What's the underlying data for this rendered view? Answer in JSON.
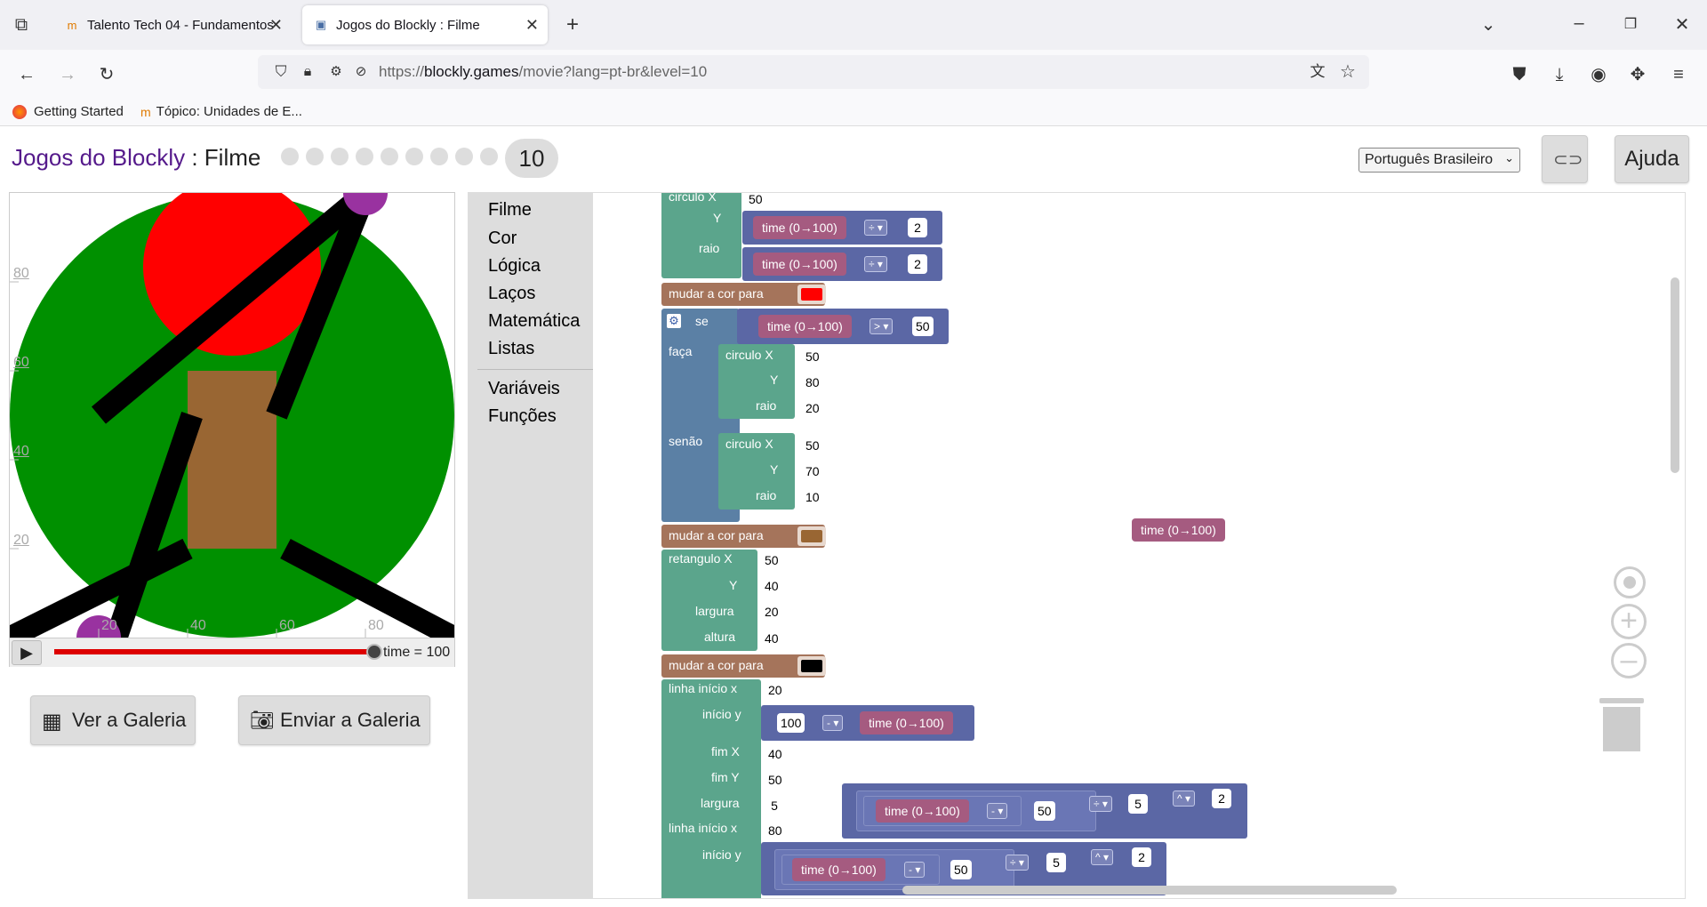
{
  "browser": {
    "tabs": [
      {
        "title": "Talento Tech 04 - Fundamentos",
        "active": false
      },
      {
        "title": "Jogos do Blockly : Filme",
        "active": true
      }
    ],
    "url_prefix": "https://",
    "url_host": "blockly.games",
    "url_path": "/movie?lang=pt-br&level=10",
    "bookmarks": [
      "Getting Started",
      "Tópico: Unidades de E..."
    ]
  },
  "header": {
    "app_link": "Jogos do Blockly",
    "separator": " : ",
    "page_name": "Filme",
    "level": "10",
    "language": "Português Brasileiro",
    "help": "Ajuda"
  },
  "movie": {
    "y_ticks": [
      "80",
      "60",
      "40",
      "20"
    ],
    "x_ticks": [
      "20",
      "40",
      "60",
      "80"
    ],
    "time_label": "time = 100",
    "progress": 1.0
  },
  "gallery": {
    "view": "Ver a Galeria",
    "submit": "Enviar a Galeria"
  },
  "toolbox": [
    "Filme",
    "Cor",
    "Lógica",
    "Laços",
    "Matemática",
    "Listas",
    "Variáveis",
    "Funções"
  ],
  "blocks": {
    "circle1_x_label": "circulo X",
    "circle1_x": "50",
    "y_label": "Y",
    "radius_label": "raio",
    "time": "time (0→100)",
    "div": "÷ ▾",
    "two": "2",
    "set_color": "mudar a cor para",
    "red": "#ff0000",
    "brown": "#996633",
    "black": "#000000",
    "if": "se",
    "gt": "> ▾",
    "fifty": "50",
    "do": "faça",
    "else": "senão",
    "c2x": "50",
    "c2y": "80",
    "c2r": "20",
    "c3x": "50",
    "c3y": "70",
    "c3r": "10",
    "rect_label": "retangulo X",
    "rect_x": "50",
    "rect_y": "40",
    "width_label": "largura",
    "rect_w": "20",
    "height_label": "altura",
    "rect_h": "40",
    "line_start_x": "linha início x",
    "line1_x": "20",
    "start_y": "início y",
    "hundred": "100",
    "minus": "- ▾",
    "end_x": "fim X",
    "line1_endx": "40",
    "end_y": "fim Y",
    "line1_endy": "50",
    "line1_w": "5",
    "line2_x": "80",
    "pow": "^ ▾",
    "five": "5"
  }
}
